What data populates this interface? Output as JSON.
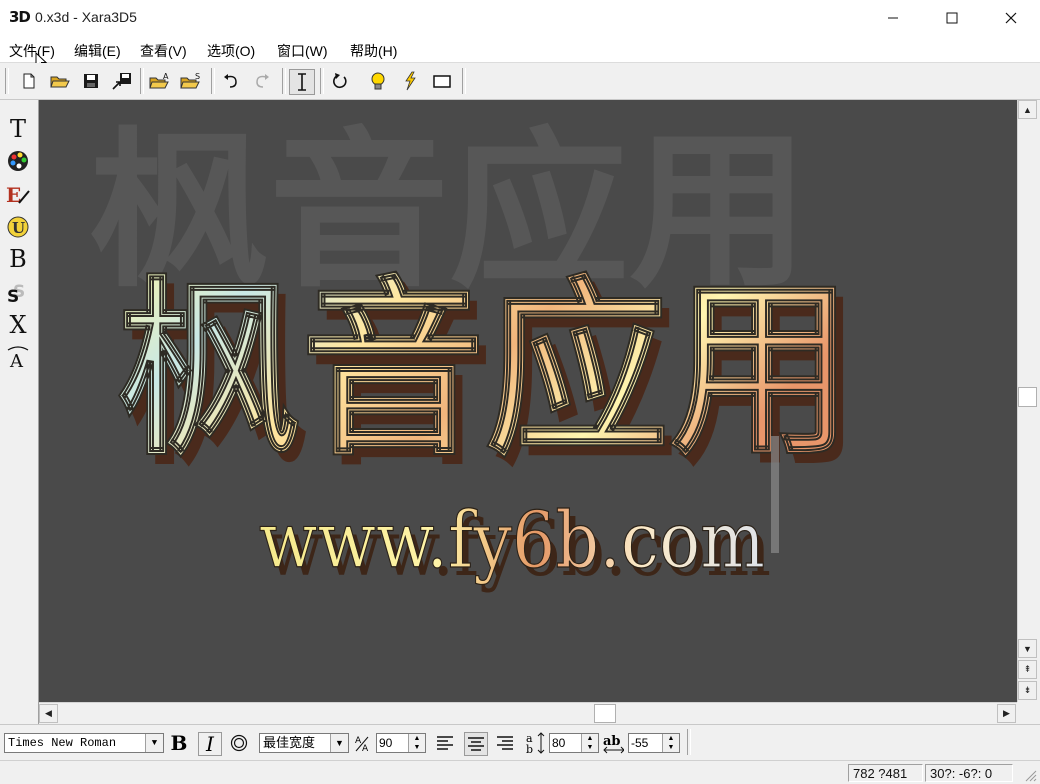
{
  "window": {
    "app_icon_text": "3D",
    "title": "0.x3d - Xara3D5",
    "minimize": "—",
    "maximize": "☐",
    "close": "✕"
  },
  "menu": [
    "文件(F)",
    "编辑(E)",
    "查看(V)",
    "选项(O)",
    "窗口(W)",
    "帮助(H)"
  ],
  "toolbar": {
    "buttons": [
      "new-file",
      "open-file",
      "save-file",
      "export",
      "open-animation",
      "open-style",
      "undo",
      "redo",
      "text-cursor",
      "rotate",
      "light",
      "lightning",
      "frame"
    ]
  },
  "left_tools": [
    "T",
    "B",
    "X"
  ],
  "left_tool_icons": [
    "text-tool",
    "color-palette",
    "texture-edit",
    "shape-tool",
    "bevel-tool",
    "shadow-tool",
    "extrude-tool",
    "text-options"
  ],
  "canvas": {
    "shadow_text": "枫音应用",
    "main_text": "枫音应用",
    "sub_text": "www.fy6b.com",
    "background_color": "#4a4a4a"
  },
  "format": {
    "font_name": "Times New Roman",
    "bold_label": "B",
    "italic_label": "I",
    "spacing_mode": "最佳宽度",
    "letter_spacing": "90",
    "line_spacing": "80",
    "word_spacing": "-55"
  },
  "status": {
    "size": "782 ?481",
    "angle": "30?: -6?: 0"
  }
}
